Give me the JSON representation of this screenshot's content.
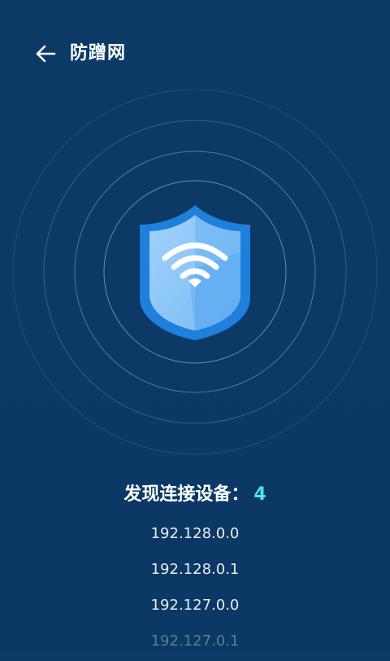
{
  "header": {
    "title": "防蹭网",
    "back_icon": "arrow-left-icon"
  },
  "scanner": {
    "shield_icon": "wifi-shield-icon",
    "colors": {
      "background": "#0c3a67",
      "shield_outer": "#1b7fe0",
      "shield_inner_light": "#8ec8f7",
      "shield_inner_dark": "#5aa9f2",
      "ring": "#5f86ad"
    }
  },
  "devices": {
    "found_label": "发现连接设备：",
    "count": "4",
    "count_color": "#4fe3f0",
    "items": [
      "192.128.0.0",
      "192.128.0.1",
      "192.127.0.0",
      "192.127.0.1"
    ]
  }
}
